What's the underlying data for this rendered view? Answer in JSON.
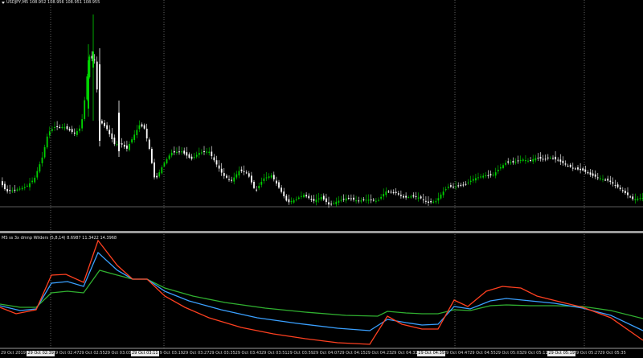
{
  "main_panel": {
    "title": "USDJPY,M5  108.952 108.956 108.951 108.955",
    "bull_color": "#00d200",
    "bear_color": "#ffffff",
    "price_line_color": "#7a7a7a",
    "grid_color": "#8a8a8a"
  },
  "indicator_panel": {
    "title": "MS ss 3x dmnp Wilders (5,8,14)  8.6987  11.3422  14.3968",
    "series_colors": [
      "#ff4020",
      "#3aa0ff",
      "#30b030"
    ]
  },
  "time_axis": {
    "labels": [
      "29 Oct 2019",
      "29 Oct 02:39",
      "29 Oct 02:47",
      "29 Oct 02:55",
      "29 Oct 03:03",
      "29 Oct 03:11",
      "29 Oct 03:19",
      "29 Oct 03:27",
      "29 Oct 03:35",
      "29 Oct 03:43",
      "29 Oct 03:51",
      "29 Oct 03:59",
      "29 Oct 04:07",
      "29 Oct 04:15",
      "29 Oct 04:23",
      "29 Oct 04:31",
      "29 Oct 04:39",
      "29 Oct 04:47",
      "29 Oct 04:55",
      "29 Oct 05:03",
      "29 Oct 05:11",
      "29 Oct 05:19",
      "29 Oct 05:27",
      "29 Oct 05:35"
    ],
    "highlighted": [
      "29 Oct 02:39",
      "29 Oct 03:11",
      "29 Oct 04:39",
      "29 Oct 05:19"
    ]
  }
}
